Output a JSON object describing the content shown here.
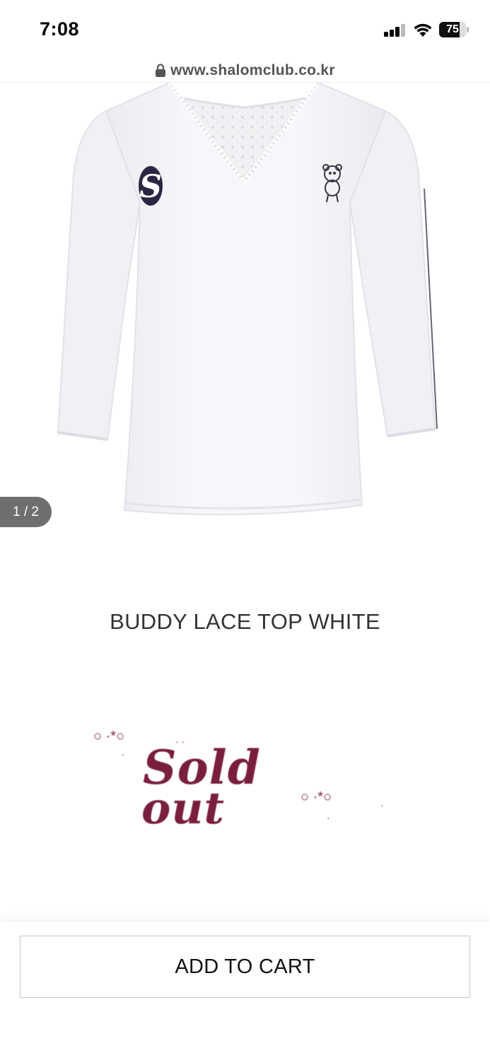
{
  "status_bar": {
    "time": "7:08",
    "battery": "75",
    "battery_level_percent": 75,
    "icons": [
      "cellular-signal-icon",
      "wifi-icon",
      "battery-icon"
    ]
  },
  "browser": {
    "url": "www.shalomclub.co.kr",
    "icon": "lock-icon"
  },
  "product": {
    "image_counter": "1 / 2",
    "title": "BUDDY LACE TOP WHITE",
    "status_badge": {
      "line1": "Sold",
      "line2": "out",
      "color": "#7a1e3d"
    }
  },
  "actions": {
    "add_to_cart": "ADD TO CART"
  }
}
